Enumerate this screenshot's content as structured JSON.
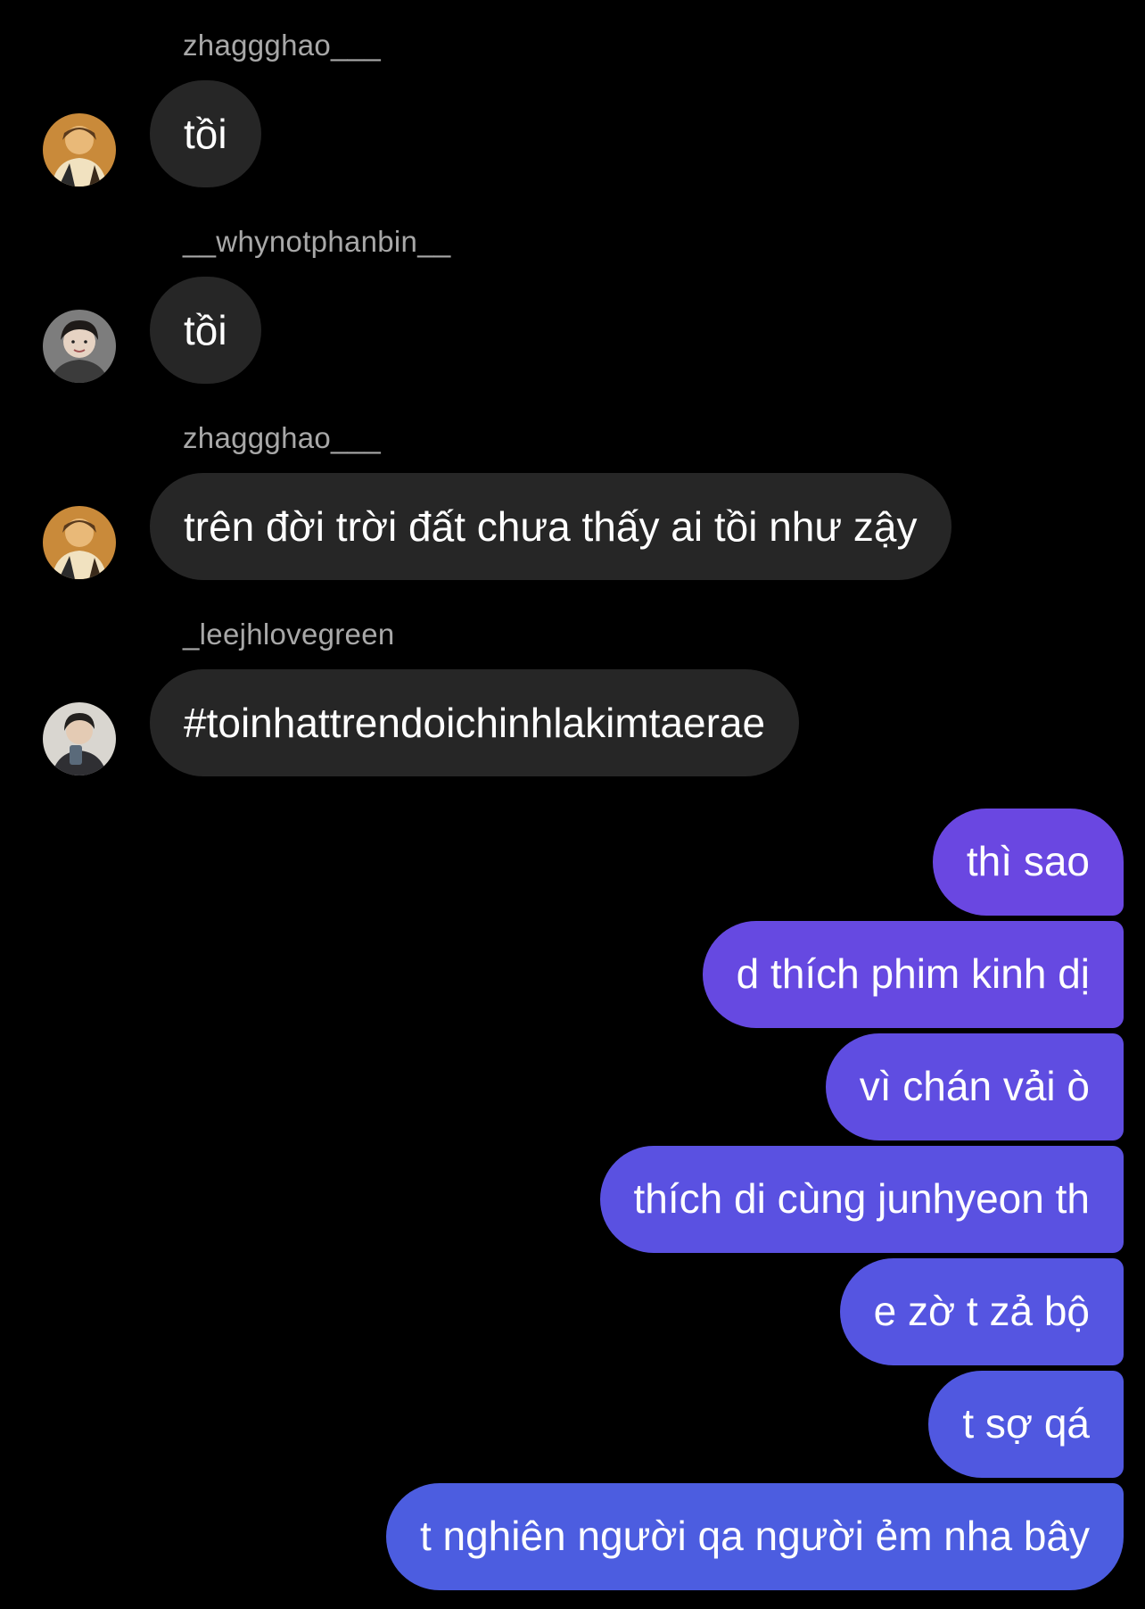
{
  "colors": {
    "background": "#000000",
    "incoming_bubble": "#262626",
    "sender_name": "#a8a8a8",
    "outgoing_gradient_top": "#6a45e0",
    "outgoing_gradient_bottom": "#4c5ee0"
  },
  "incoming": [
    {
      "sender": "zhaggghao___",
      "text": "tồi",
      "avatar": "avatar-zhaggghao"
    },
    {
      "sender": "__whynotphanbin__",
      "text": "tồi",
      "avatar": "avatar-whynotphanbin"
    },
    {
      "sender": "zhaggghao___",
      "text": "trên đời trời đất chưa thấy ai tồi như zậy",
      "avatar": "avatar-zhaggghao"
    },
    {
      "sender": "_leejhlovegreen",
      "text": "#toinhattrendoichinhlakimtaerae",
      "avatar": "avatar-leejhlovegreen"
    }
  ],
  "outgoing": [
    {
      "text": "thì sao"
    },
    {
      "text": "d thích phim kinh dị"
    },
    {
      "text": "vì chán vải ò"
    },
    {
      "text": "thích di cùng junhyeon th"
    },
    {
      "text": "e zờ t zả bộ"
    },
    {
      "text": "t sợ qá"
    },
    {
      "text": "t nghiên người qa người ẻm nha bây"
    }
  ]
}
